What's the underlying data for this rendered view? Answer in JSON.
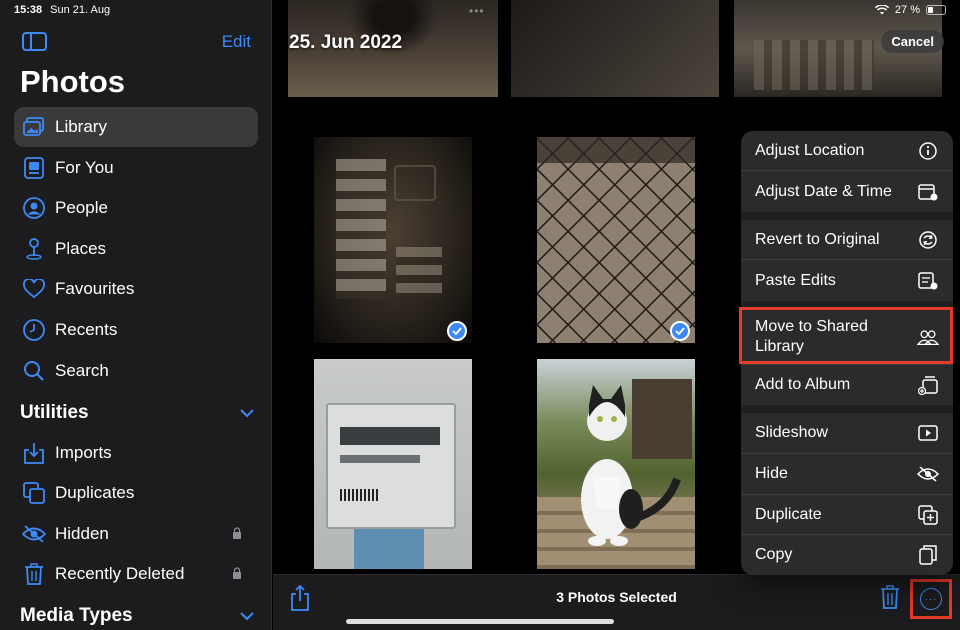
{
  "status_bar": {
    "time": "15:38",
    "date": "Sun 21. Aug",
    "battery": "27 %"
  },
  "sidebar": {
    "edit_label": "Edit",
    "title": "Photos",
    "items": [
      {
        "label": "Library",
        "icon": "library-icon"
      },
      {
        "label": "For You",
        "icon": "for-you-icon"
      },
      {
        "label": "People",
        "icon": "person-icon"
      },
      {
        "label": "Places",
        "icon": "pin-icon"
      },
      {
        "label": "Favourites",
        "icon": "heart-icon"
      },
      {
        "label": "Recents",
        "icon": "clock-icon"
      },
      {
        "label": "Search",
        "icon": "search-icon"
      }
    ],
    "utilities_title": "Utilities",
    "utilities": [
      {
        "label": "Imports",
        "icon": "import-icon"
      },
      {
        "label": "Duplicates",
        "icon": "duplicate-icon"
      },
      {
        "label": "Hidden",
        "icon": "eye-slash-icon"
      },
      {
        "label": "Recently Deleted",
        "icon": "trash-icon"
      }
    ],
    "media_types_title": "Media Types"
  },
  "main": {
    "date_heading": "25. Jun 2022",
    "cancel_label": "Cancel"
  },
  "toolbar": {
    "selected_count": "3 Photos Selected"
  },
  "menu": {
    "items": [
      {
        "label": "Adjust Location",
        "icon": "info-icon"
      },
      {
        "label": "Adjust Date & Time",
        "icon": "calendar-icon"
      },
      {
        "label": "Revert to Original",
        "icon": "revert-icon"
      },
      {
        "label": "Paste Edits",
        "icon": "paste-edits-icon"
      },
      {
        "label": "Move to Shared Library",
        "icon": "people-icon"
      },
      {
        "label": "Add to Album",
        "icon": "add-album-icon"
      },
      {
        "label": "Slideshow",
        "icon": "play-icon"
      },
      {
        "label": "Hide",
        "icon": "eye-slash-icon"
      },
      {
        "label": "Duplicate",
        "icon": "duplicate-icon"
      },
      {
        "label": "Copy",
        "icon": "copy-icon"
      }
    ]
  },
  "colors": {
    "accent": "#3d8af7",
    "highlight": "#e53b2c",
    "sidebar_bg": "#1c1c1e",
    "menu_bg": "#2c2c2e"
  }
}
